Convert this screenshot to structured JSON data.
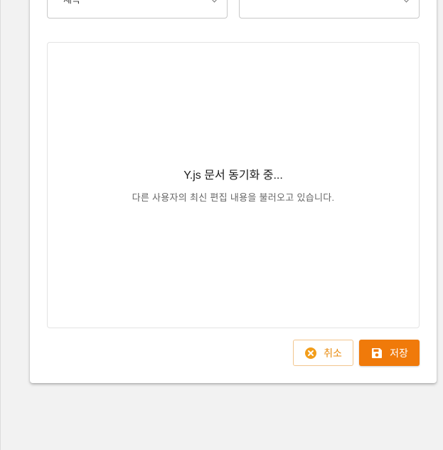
{
  "form": {
    "left_select_value": "제목",
    "right_select_value": ""
  },
  "editor": {
    "sync_title": "Y.js 문서 동기화 중...",
    "sync_subtitle": "다른 사용자의 최신 편집 내용을 불러오고 있습니다."
  },
  "actions": {
    "cancel_label": "취소",
    "save_label": "저장",
    "cancel_icon": "close-circle-icon",
    "save_icon": "floppy-disk-icon"
  },
  "colors": {
    "accent": "#f07a0a",
    "cancel_text": "#e8890b",
    "background": "#f2f2f2"
  }
}
